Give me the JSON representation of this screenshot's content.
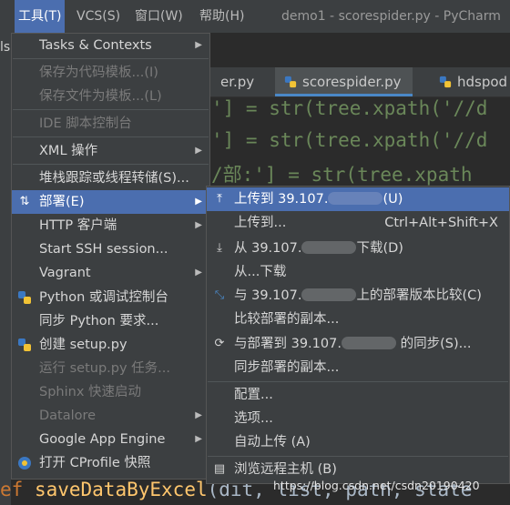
{
  "menubar": {
    "items": [
      {
        "label": "工具(T)"
      },
      {
        "label": "VCS(S)"
      },
      {
        "label": "窗口(W)"
      },
      {
        "label": "帮助(H)"
      }
    ],
    "window_title": "demo1 - scorespider.py - PyCharm"
  },
  "left_strip_text": "ls",
  "editor": {
    "tabs": [
      {
        "label": "er.py"
      },
      {
        "label": "scorespider.py"
      },
      {
        "label": "hdspod"
      }
    ]
  },
  "tools_menu": {
    "items": [
      {
        "label": "Tasks & Contexts",
        "submenu": true,
        "enabled": true
      },
      {
        "label": "保存为代码模板...(I)",
        "enabled": false
      },
      {
        "label": "保存文件为模板...(L)",
        "enabled": false
      },
      {
        "label": "IDE 脚本控制台",
        "enabled": false
      },
      {
        "label": "XML 操作",
        "submenu": true,
        "enabled": true
      },
      {
        "label": "堆栈跟踪或线程转储(S)...",
        "enabled": true
      },
      {
        "label": "部署(E)",
        "submenu": true,
        "enabled": true,
        "selected": true,
        "icon": "deployment-icon"
      },
      {
        "label": "HTTP 客户端",
        "submenu": true,
        "enabled": true
      },
      {
        "label": "Start SSH session...",
        "enabled": true
      },
      {
        "label": "Vagrant",
        "submenu": true,
        "enabled": true
      },
      {
        "label": "Python 或调试控制台",
        "enabled": true,
        "icon": "python-icon"
      },
      {
        "label": "同步 Python 要求...",
        "enabled": true
      },
      {
        "label": "创建 setup.py",
        "enabled": true,
        "icon": "python-icon"
      },
      {
        "label": "运行 setup.py 任务...",
        "enabled": false
      },
      {
        "label": "Sphinx 快速启动",
        "enabled": false
      },
      {
        "label": "Datalore",
        "submenu": true,
        "enabled": false
      },
      {
        "label": "Google App Engine",
        "submenu": true,
        "enabled": true
      },
      {
        "label": "打开 CProfile 快照",
        "enabled": true,
        "icon": "profiler-icon"
      }
    ]
  },
  "deployment_menu": {
    "items": [
      {
        "prefix": "上传到 39.107.",
        "suffix": "(U)",
        "masked": true,
        "selected": true,
        "icon": "upload-icon"
      },
      {
        "prefix": "上传到...",
        "shortcut": "Ctrl+Alt+Shift+X"
      },
      {
        "prefix": "从 39.107.",
        "suffix": "下载(D)",
        "masked": true,
        "icon": "download-icon"
      },
      {
        "prefix": "从...下载"
      },
      {
        "prefix": "与 39.107.",
        "suffix": "上的部署版本比较(C)",
        "masked": true,
        "icon": "compare-icon"
      },
      {
        "prefix": "比较部署的副本..."
      },
      {
        "prefix": "与部署到 39.107.",
        "suffix": " 的同步(S)...",
        "masked": true,
        "icon": "sync-icon"
      },
      {
        "prefix": "同步部署的副本..."
      },
      {
        "prefix": "配置..."
      },
      {
        "prefix": "选项..."
      },
      {
        "prefix": "自动上传 (A)"
      },
      {
        "prefix": "浏览远程主机 (B)",
        "icon": "remote-host-icon"
      }
    ]
  },
  "code": {
    "line1": "'] = str(tree.xpath('//d",
    "line2": "'] = str(tree.xpath('//d",
    "line3": "/部:'] = str(tree.xpath",
    "bottom_keyword": "ef",
    "bottom_func": "saveDataByExcel",
    "bottom_args": "(dit, list, path, state"
  },
  "watermark": "https://blog.csdn.net/csdn20190420",
  "colors": {
    "accent": "#4b6eaf",
    "menu_bg": "#3c3f41",
    "editor_bg": "#2b2b2b"
  }
}
